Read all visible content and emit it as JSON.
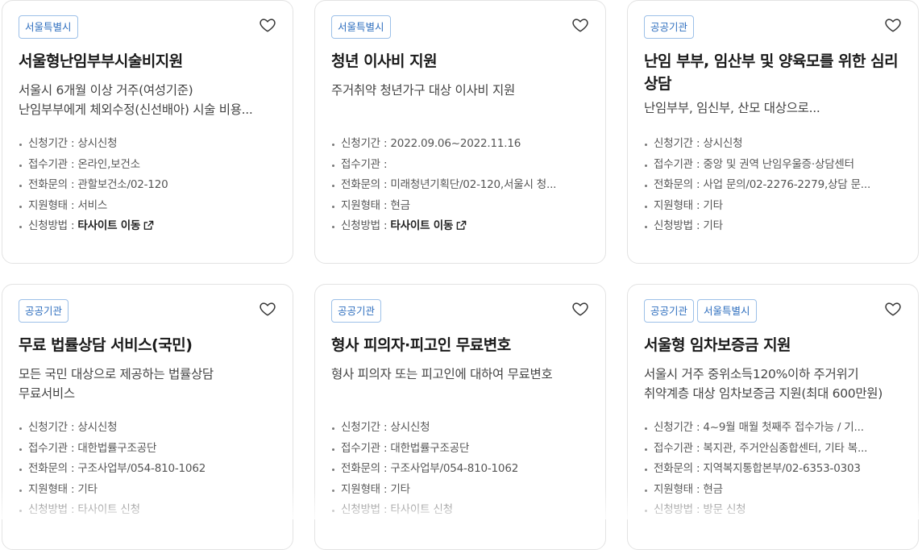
{
  "cards": [
    {
      "tags": [
        "서울특별시"
      ],
      "title": "서울형난임부부시술비지원",
      "desc": [
        "서울시 6개월 이상 거주(여성기준)",
        "난임부부에게 체외수정(신선배아) 시술 비용..."
      ],
      "info": [
        "신청기간 : 상시신청",
        "접수기관 : 온라인,보건소",
        "전화문의 : 관할보건소/02-120",
        "지원형태 : 서비스"
      ],
      "method_label": "신청방법 : ",
      "method_value": "타사이트 이동",
      "method_icon": "external-link-icon"
    },
    {
      "tags": [
        "서울특별시"
      ],
      "title": "청년 이사비 지원",
      "desc": [
        "주거취약 청년가구 대상 이사비 지원"
      ],
      "info": [
        "신청기간 : 2022.09.06~2022.11.16",
        "접수기관 :",
        "전화문의 : 미래청년기획단/02-120,서울시 청...",
        "지원형태 : 현금"
      ],
      "method_label": "신청방법 : ",
      "method_value": "타사이트 이동",
      "method_icon": "external-link-icon"
    },
    {
      "tags": [
        "공공기관"
      ],
      "title": "난임 부부, 임산부 및 양육모를 위한 심리 상담",
      "desc": [
        "난임부부, 임신부, 산모 대상으로..."
      ],
      "info": [
        "신청기간 : 상시신청",
        "접수기관 : 중앙 및 권역 난임우울증·상담센터",
        "전화문의 : 사업 문의/02-2276-2279,상담 문...",
        "지원형태 : 기타"
      ],
      "method_label": "신청방법 : 기타",
      "method_value": ""
    },
    {
      "tags": [
        "공공기관"
      ],
      "title": "무료 법률상담 서비스(국민)",
      "desc": [
        "모든 국민 대상으로 제공하는 법률상담",
        "무료서비스"
      ],
      "info": [
        "신청기간 : 상시신청",
        "접수기관 : 대한법률구조공단",
        "전화문의 : 구조사업부/054-810-1062",
        "지원형태 : 기타"
      ],
      "method_label": "신청방법 : 타사이트 신청",
      "method_value": ""
    },
    {
      "tags": [
        "공공기관"
      ],
      "title": "형사 피의자·피고인 무료변호",
      "desc": [
        "형사 피의자 또는 피고인에 대하여 무료변호"
      ],
      "info": [
        "신청기간 : 상시신청",
        "접수기관 : 대한법률구조공단",
        "전화문의 : 구조사업부/054-810-1062",
        "지원형태 : 기타"
      ],
      "method_label": "신청방법 : 타사이트 신청",
      "method_value": ""
    },
    {
      "tags": [
        "공공기관",
        "서울특별시"
      ],
      "title": "서울형 임차보증금 지원",
      "desc": [
        "서울시 거주 중위소득120%이하 주거위기",
        "취약계층 대상 임차보증금 지원(최대 600만원)"
      ],
      "info": [
        "신청기간 : 4~9월 매월 첫째주 접수가능 / 기...",
        "접수기관 : 복지관, 주거안심종합센터, 기타 복...",
        "전화문의 : 지역복지통합본부/02-6353-0303",
        "지원형태 : 현금"
      ],
      "method_label": "신청방법 : 방문 신청",
      "method_value": ""
    }
  ],
  "colors": {
    "tag_border": "#9cc0e8",
    "tag_text": "#2f6fbf",
    "card_border": "#e3e3e3"
  },
  "icons": {
    "favorite": "heart-outline-icon"
  }
}
